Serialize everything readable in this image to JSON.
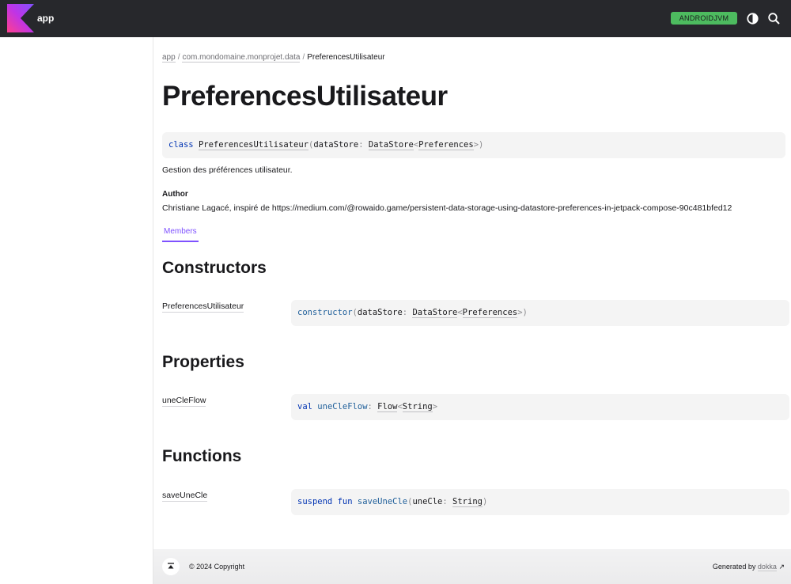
{
  "header": {
    "app_name": "app",
    "platform_badge": "ANDROIDJVM",
    "theme_icon": "contrast-icon",
    "search_icon": "search-icon",
    "colors": {
      "bar": "#27282c",
      "badge": "#4dbb5f"
    }
  },
  "breadcrumb": {
    "items": [
      "app",
      "com.mondomaine.monprojet.data",
      "PreferencesUtilisateur"
    ],
    "separator": "/"
  },
  "page": {
    "title": "PreferencesUtilisateur",
    "signature": {
      "keyword": "class",
      "name": "PreferencesUtilisateur",
      "open_paren": "(",
      "param": "dataStore",
      "colon": ":",
      "type": "DataStore",
      "lt": "<",
      "type_arg": "Preferences",
      "gt": ">",
      "close_paren": ")"
    },
    "description": "Gestion des préférences utilisateur.",
    "author_label": "Author",
    "author_text": "Christiane Lagacé, inspiré de https://medium.com/@rowaido.game/persistent-data-storage-using-datastore-preferences-in-jetpack-compose-90c481bfed12",
    "tab_label": "Members"
  },
  "constructors": {
    "title": "Constructors",
    "name": "PreferencesUtilisateur",
    "keyword": "constructor",
    "open_paren": "(",
    "param": "dataStore",
    "colon": ":",
    "type": "DataStore",
    "lt": "<",
    "type_arg": "Preferences",
    "gt": ">",
    "close_paren": ")"
  },
  "properties": {
    "title": "Properties",
    "name": "uneCleFlow",
    "keyword": "val",
    "prop": "uneCleFlow",
    "colon": ":",
    "type": "Flow",
    "lt": "<",
    "type_arg": "String",
    "gt": ">"
  },
  "functions": {
    "title": "Functions",
    "name": "saveUneCle",
    "keyword1": "suspend",
    "keyword2": "fun",
    "fn": "saveUneCle",
    "open_paren": "(",
    "param": "uneCle",
    "colon": ":",
    "type": "String",
    "close_paren": ")"
  },
  "footer": {
    "go_top_icon": "arrow-up-to-top-icon",
    "copyright": "© 2024 Copyright",
    "generated_by": "Generated by",
    "dokka": "dokka",
    "external_icon": "↗"
  }
}
